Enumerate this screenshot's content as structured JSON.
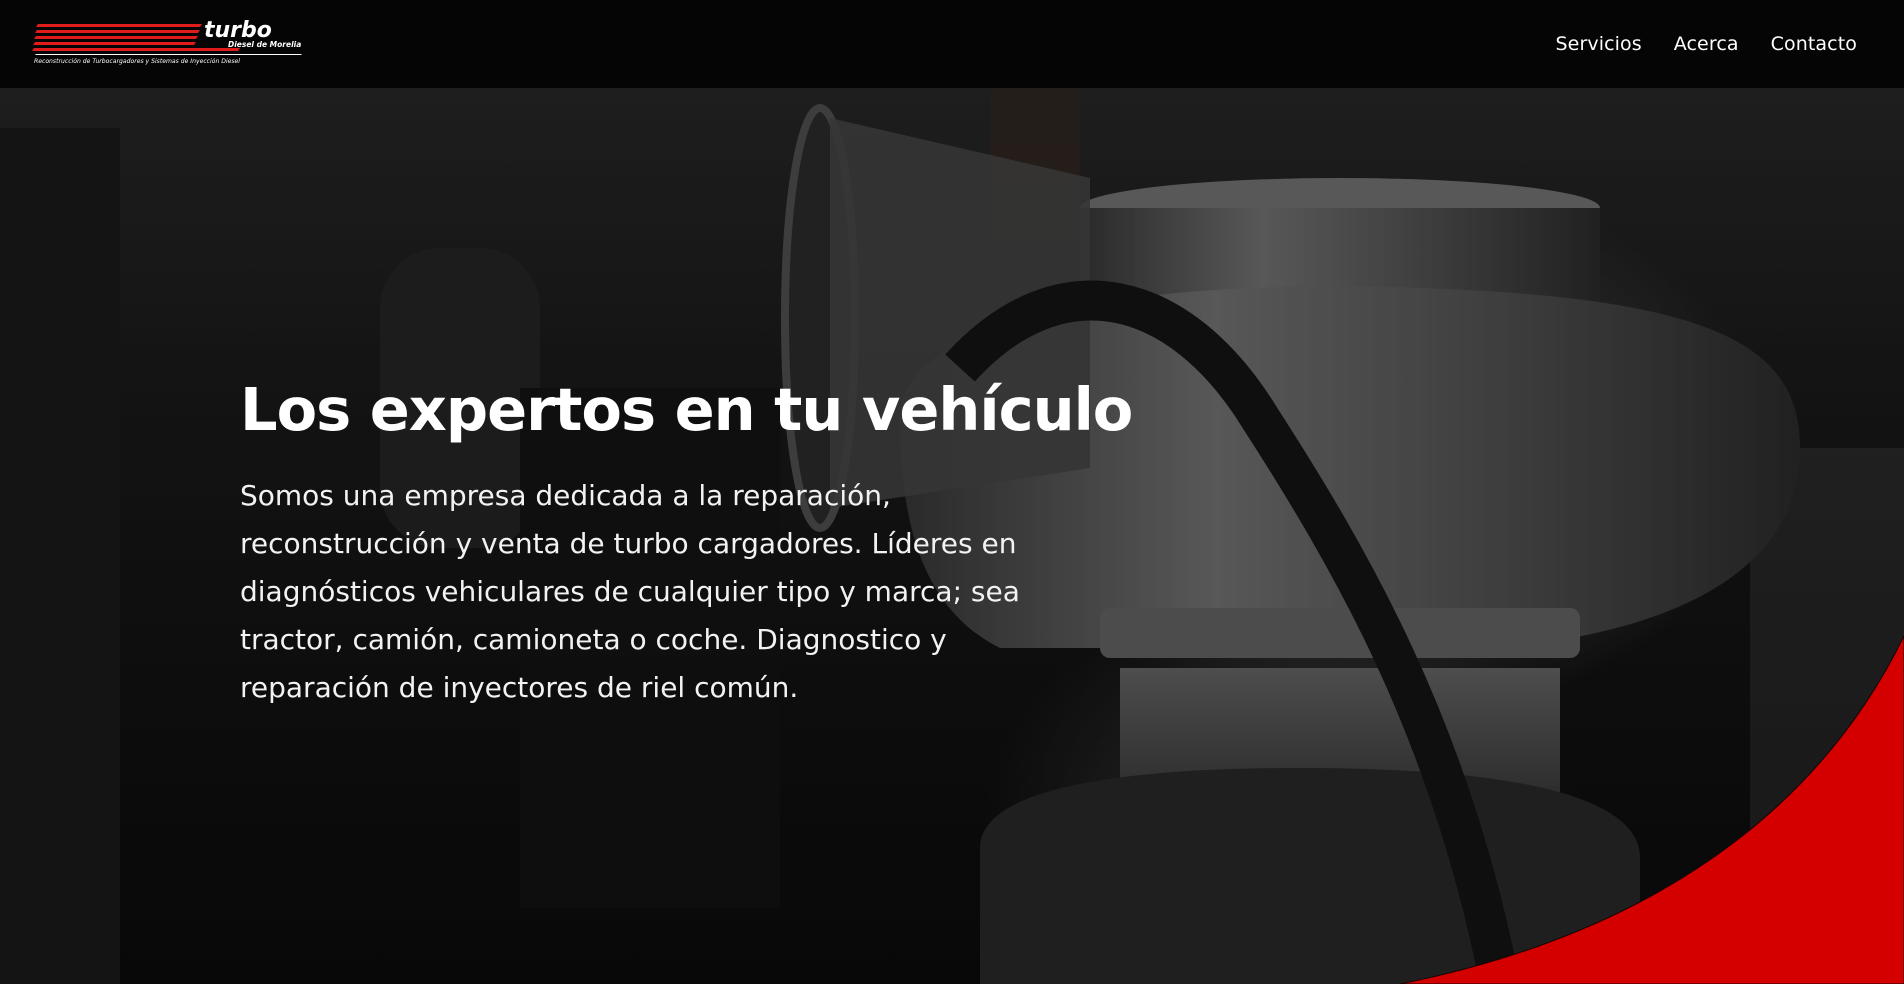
{
  "header": {
    "logo": {
      "wordmark": "turbo",
      "tagline": "Diesel de Morelia",
      "subline": "Reconstrucción de Turbocargadores y Sistemas de Inyección Diesel"
    },
    "nav": [
      "Servicios",
      "Acerca",
      "Contacto"
    ]
  },
  "hero": {
    "title": "Los expertos en tu vehículo",
    "text": "Somos una empresa dedicada a la reparación, reconstrucción y venta de turbo cargadores. Líderes en diagnósticos vehiculares de cualquier tipo y marca; sea tractor, camión, camioneta o coche. Diagnostico y reparación de inyectores de riel común.",
    "background_image": "turbocharger-photo"
  },
  "colors": {
    "header_bg": "#050505",
    "accent_red": "#d40000",
    "text": "#ffffff"
  }
}
